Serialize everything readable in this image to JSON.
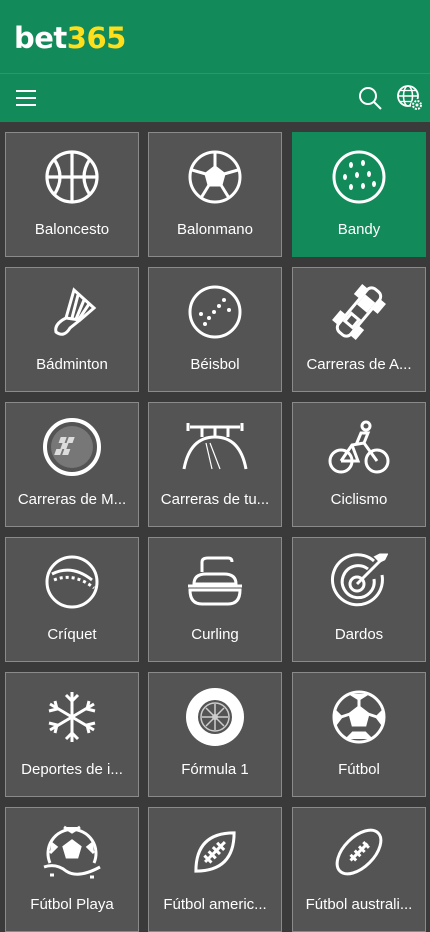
{
  "brand": {
    "part1": "bet",
    "part2": "365"
  },
  "colors": {
    "header_green": "#138a5a",
    "active_tile": "#138a5a",
    "tile_bg": "#545454",
    "logo_yellow": "#ffdf1b"
  },
  "toolbar": {
    "icons": [
      "menu-icon",
      "search-icon",
      "globe-settings-icon"
    ]
  },
  "sports": [
    {
      "label": "Baloncesto",
      "icon": "basketball-icon"
    },
    {
      "label": "Balonmano",
      "icon": "handball-icon"
    },
    {
      "label": "Bandy",
      "icon": "bandy-ball-icon",
      "selected": true
    },
    {
      "label": "Bádminton",
      "icon": "shuttlecock-icon"
    },
    {
      "label": "Béisbol",
      "icon": "baseball-icon"
    },
    {
      "label": "Carreras de A...",
      "icon": "race-car-icon"
    },
    {
      "label": "Carreras de M...",
      "icon": "motorbike-racing-icon"
    },
    {
      "label": "Carreras de tu...",
      "icon": "race-track-icon"
    },
    {
      "label": "Ciclismo",
      "icon": "cyclist-icon"
    },
    {
      "label": "Críquet",
      "icon": "cricket-ball-icon"
    },
    {
      "label": "Curling",
      "icon": "curling-stone-icon"
    },
    {
      "label": "Dardos",
      "icon": "dartboard-icon"
    },
    {
      "label": "Deportes de i...",
      "icon": "snowflake-icon"
    },
    {
      "label": "Fórmula 1",
      "icon": "tyre-icon"
    },
    {
      "label": "Fútbol",
      "icon": "soccer-ball-icon"
    },
    {
      "label": "Fútbol Playa",
      "icon": "beach-soccer-icon"
    },
    {
      "label": "Fútbol americ...",
      "icon": "american-football-icon"
    },
    {
      "label": "Fútbol australi...",
      "icon": "australian-football-icon"
    }
  ]
}
